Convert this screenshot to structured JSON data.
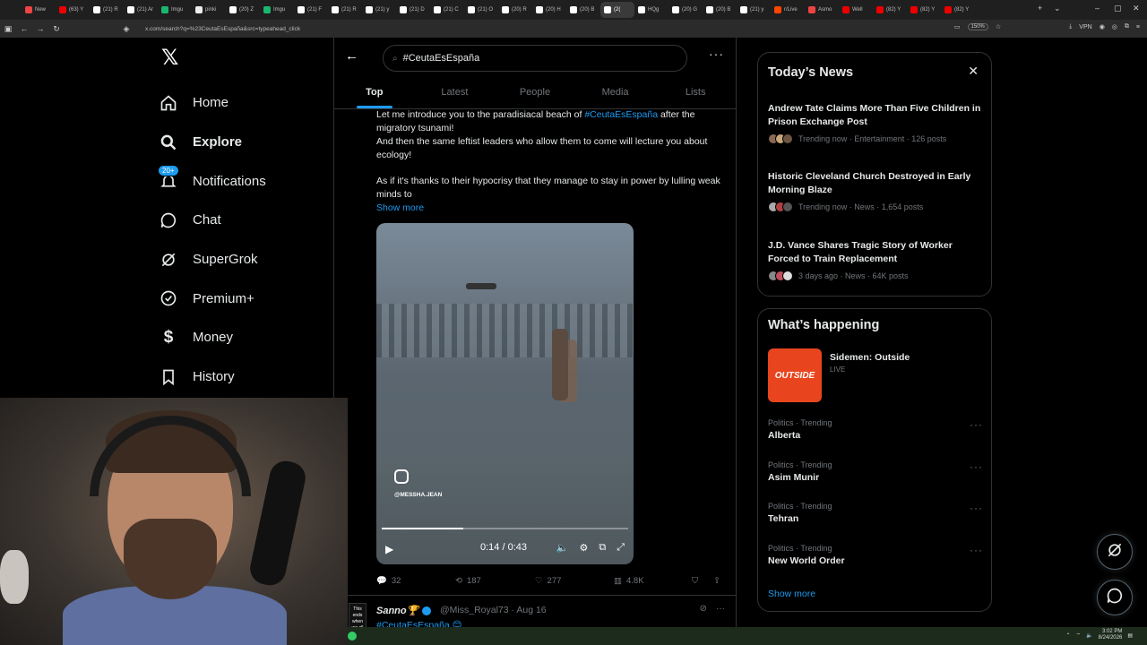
{
  "browser": {
    "tabs": [
      {
        "label": "New",
        "color": "#e44"
      },
      {
        "label": "(63) Y",
        "color": "#e00"
      },
      {
        "label": "(21) R",
        "color": "#fff"
      },
      {
        "label": "(21) Ar",
        "color": "#fff"
      },
      {
        "label": "Imgu",
        "color": "#1bb76e"
      },
      {
        "label": "pinki",
        "color": "#eee"
      },
      {
        "label": "(20) Z",
        "color": "#fff"
      },
      {
        "label": "Imgu",
        "color": "#1bb76e"
      },
      {
        "label": "(21) F",
        "color": "#fff"
      },
      {
        "label": "(21) R",
        "color": "#fff"
      },
      {
        "label": "(21) y",
        "color": "#fff"
      },
      {
        "label": "(21) D",
        "color": "#fff"
      },
      {
        "label": "(21) C",
        "color": "#fff"
      },
      {
        "label": "(21) O",
        "color": "#fff"
      },
      {
        "label": "(20) R",
        "color": "#fff"
      },
      {
        "label": "(20) H",
        "color": "#fff"
      },
      {
        "label": "(20) B",
        "color": "#fff"
      },
      {
        "label": "(2(",
        "color": "#fff"
      },
      {
        "label": "HQg",
        "color": "#fff"
      },
      {
        "label": "(20) G",
        "color": "#fff"
      },
      {
        "label": "(20) B",
        "color": "#fff"
      },
      {
        "label": "(21) y",
        "color": "#fff"
      },
      {
        "label": "r/Live",
        "color": "#ff4500"
      },
      {
        "label": "Asmo",
        "color": "#e44"
      },
      {
        "label": "Well",
        "color": "#e00"
      },
      {
        "label": "(82) Y",
        "color": "#e00"
      },
      {
        "label": "(82) Y",
        "color": "#e00"
      },
      {
        "label": "(82) Y",
        "color": "#e00"
      }
    ],
    "active_tab_index": 17,
    "url": "x.com/search?q=%23CeutaEsEspaña&src=typeahead_click",
    "zoom": "150%",
    "vpn_label": "VPN"
  },
  "nav": {
    "logo": "𝕏",
    "items": [
      {
        "label": "Home",
        "icon": "home-icon"
      },
      {
        "label": "Explore",
        "icon": "search-icon"
      },
      {
        "label": "Notifications",
        "icon": "bell-icon",
        "badge": "20+"
      },
      {
        "label": "Chat",
        "icon": "chat-icon"
      },
      {
        "label": "SuperGrok",
        "icon": "grok-icon"
      },
      {
        "label": "Premium+",
        "icon": "verified-icon"
      },
      {
        "label": "Money",
        "icon": "dollar-icon"
      },
      {
        "label": "History",
        "icon": "bookmark-icon"
      }
    ]
  },
  "search": {
    "query": "#CeutaEsEspaña",
    "tabs": [
      "Top",
      "Latest",
      "People",
      "Media",
      "Lists"
    ]
  },
  "post": {
    "line1_pre": "Let me introduce you to the paradisiacal beach of ",
    "line1_hashtag": "#CeutaEsEspaña",
    "line1_post": " after the migratory tsunami!",
    "line2": "And then the same leftist leaders who allow them to come will lecture you about ecology!",
    "line3": "As if it's thanks to their hypocrisy that they manage to stay in power by lulling weak minds to",
    "show_more": "Show more",
    "video": {
      "handle": "@MESSHA.JEAN",
      "time": "0:14 / 0:43",
      "progress": 0.33
    },
    "stats": {
      "replies": "32",
      "reposts": "187",
      "likes": "277",
      "views": "4.8K"
    }
  },
  "next_post": {
    "avatar_text": "This ends when we all say NO",
    "name": "Sanno🏆",
    "handle": "@Miss_Royal73 · Aug 16",
    "hashtag": "#CeutaEsEspaña 😊"
  },
  "todays_news": {
    "title": "Today’s News",
    "items": [
      {
        "title": "Andrew Tate Claims More Than Five Children in Prison Exchange Post",
        "meta": "Trending now · Entertainment · 126 posts"
      },
      {
        "title": "Historic Cleveland Church Destroyed in Early Morning Blaze",
        "meta": "Trending now · News · 1,654 posts"
      },
      {
        "title": "J.D. Vance Shares Tragic Story of Worker Forced to Train Replacement",
        "meta": "3 days ago · News · 64K posts"
      }
    ]
  },
  "whats_happening": {
    "title": "What’s happening",
    "live": {
      "thumb": "OUTSIDE",
      "title": "Sidemen: Outside",
      "status": "LIVE"
    },
    "trends": [
      {
        "category": "Politics · Trending",
        "name": "Alberta"
      },
      {
        "category": "Politics · Trending",
        "name": "Asim Munir"
      },
      {
        "category": "Politics · Trending",
        "name": "Tehran"
      },
      {
        "category": "Politics · Trending",
        "name": "New World Order"
      }
    ],
    "show_more": "Show more"
  },
  "taskbar": {
    "time": "3:02 PM",
    "date": "8/24/2026"
  },
  "colors": {
    "accent": "#1d9bf0",
    "bg": "#000000",
    "border": "#2f3336",
    "muted": "#71767b"
  }
}
